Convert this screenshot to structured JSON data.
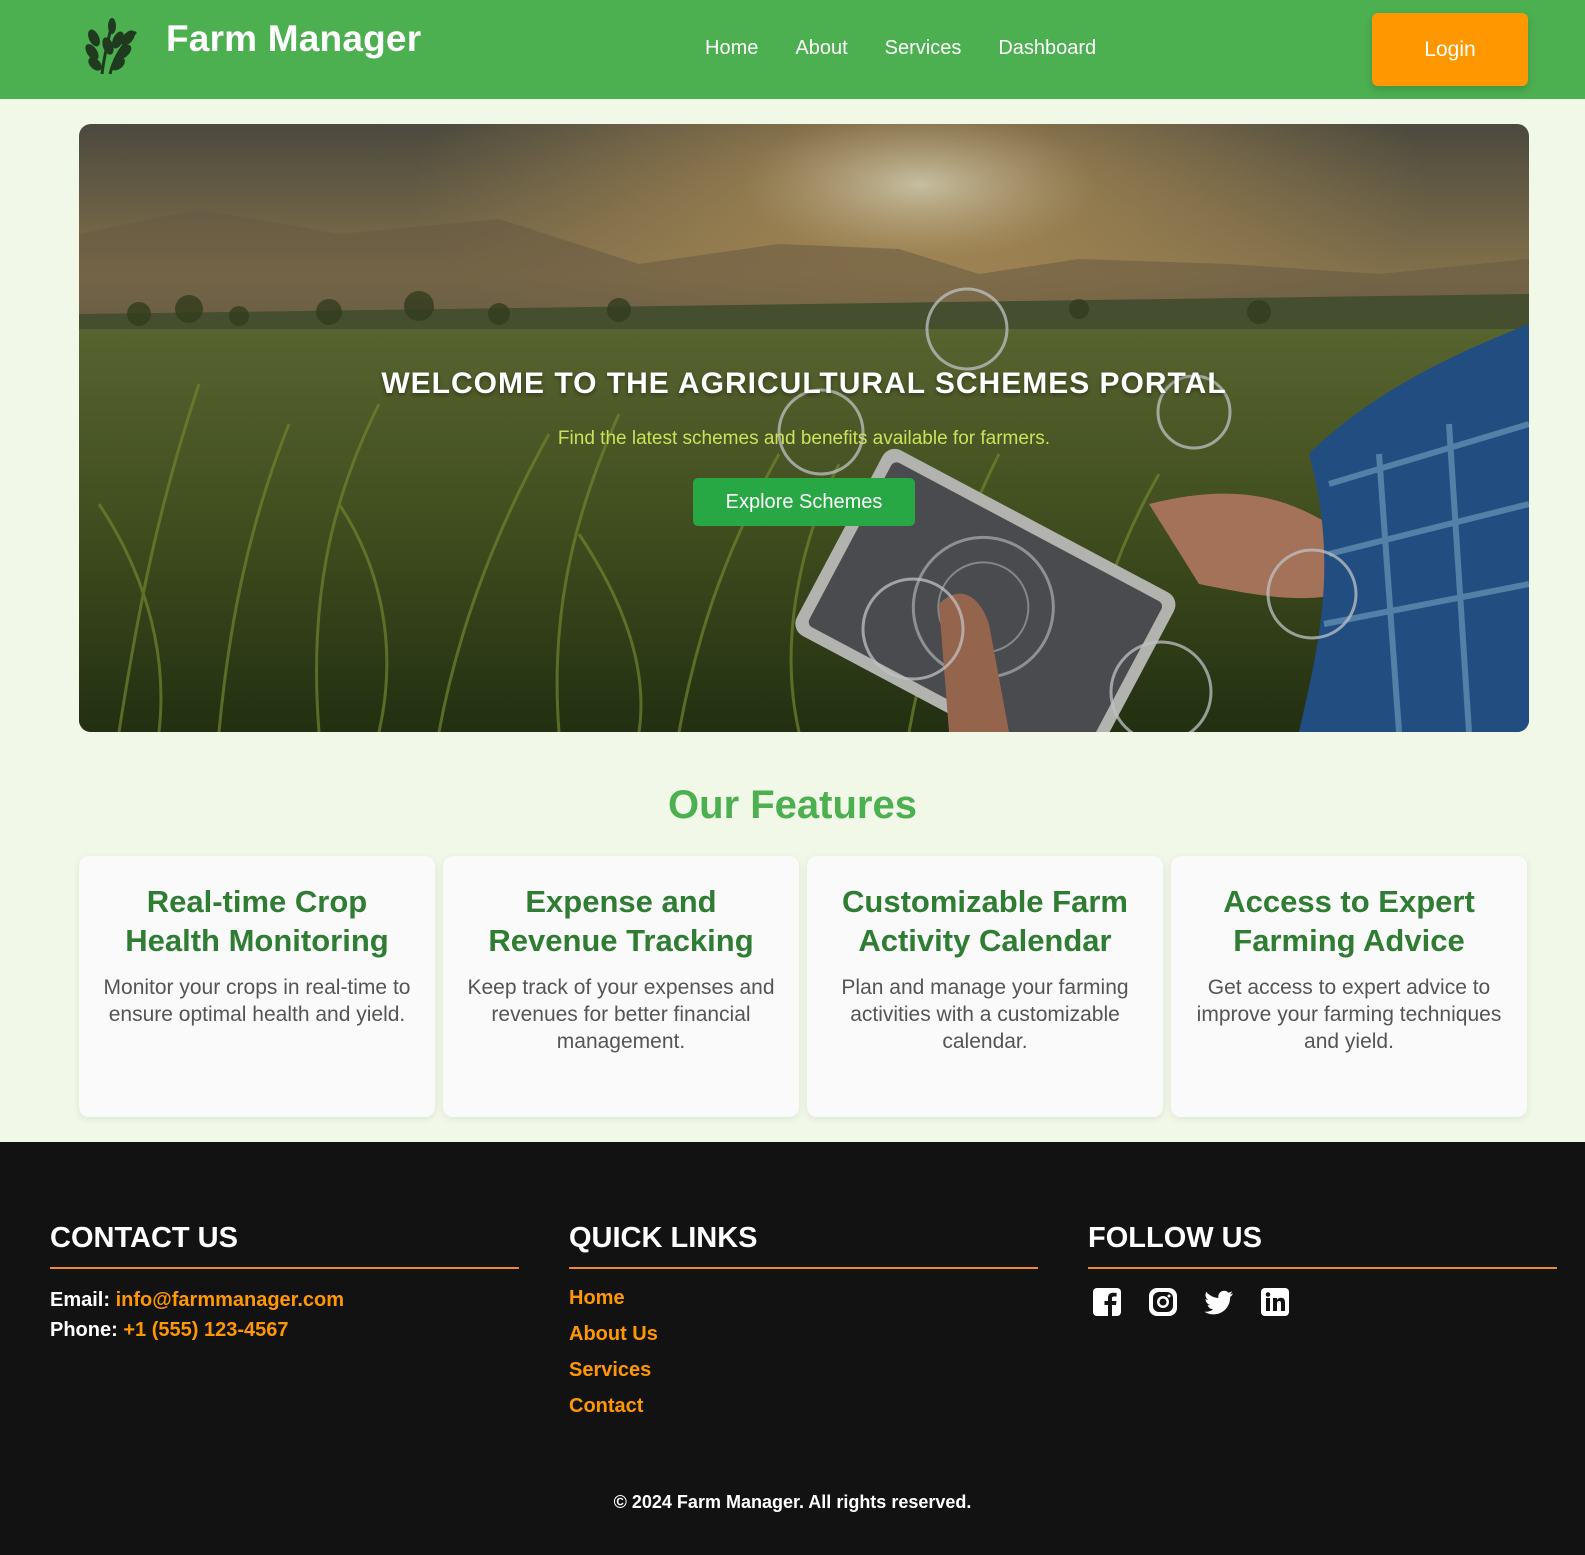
{
  "header": {
    "brand": "Farm Manager",
    "nav": [
      "Home",
      "About",
      "Services",
      "Dashboard"
    ],
    "login_label": "Login"
  },
  "hero": {
    "title": "WELCOME TO THE AGRICULTURAL SCHEMES PORTAL",
    "subtitle": "Find the latest schemes and benefits available for farmers.",
    "button_label": "Explore Schemes"
  },
  "features": {
    "title": "Our Features",
    "cards": [
      {
        "title": "Real-time Crop Health Monitoring",
        "desc": "Monitor your crops in real-time to ensure optimal health and yield."
      },
      {
        "title": "Expense and Revenue Tracking",
        "desc": "Keep track of your expenses and revenues for better financial management."
      },
      {
        "title": "Customizable Farm Activity Calendar",
        "desc": "Plan and manage your farming activities with a customizable calendar."
      },
      {
        "title": "Access to Expert Farming Advice",
        "desc": "Get access to expert advice to improve your farming techniques and yield."
      }
    ]
  },
  "footer": {
    "contact": {
      "heading": "CONTACT US",
      "email_label": "Email:",
      "email": "info@farmmanager.com",
      "phone_label": "Phone:",
      "phone": "+1 (555) 123-4567"
    },
    "quick_links": {
      "heading": "QUICK LINKS",
      "links": [
        "Home",
        "About Us",
        "Services",
        "Contact"
      ]
    },
    "follow": {
      "heading": "FOLLOW US",
      "icons": [
        "facebook-icon",
        "instagram-icon",
        "twitter-icon",
        "linkedin-icon"
      ]
    },
    "copyright": "© 2024 Farm Manager. All rights reserved."
  },
  "colors": {
    "header_bg": "#4caf50",
    "accent_orange": "#ff9800",
    "cta_green": "#28a745",
    "page_bg": "#f1f8e7",
    "footer_bg": "#121212"
  }
}
